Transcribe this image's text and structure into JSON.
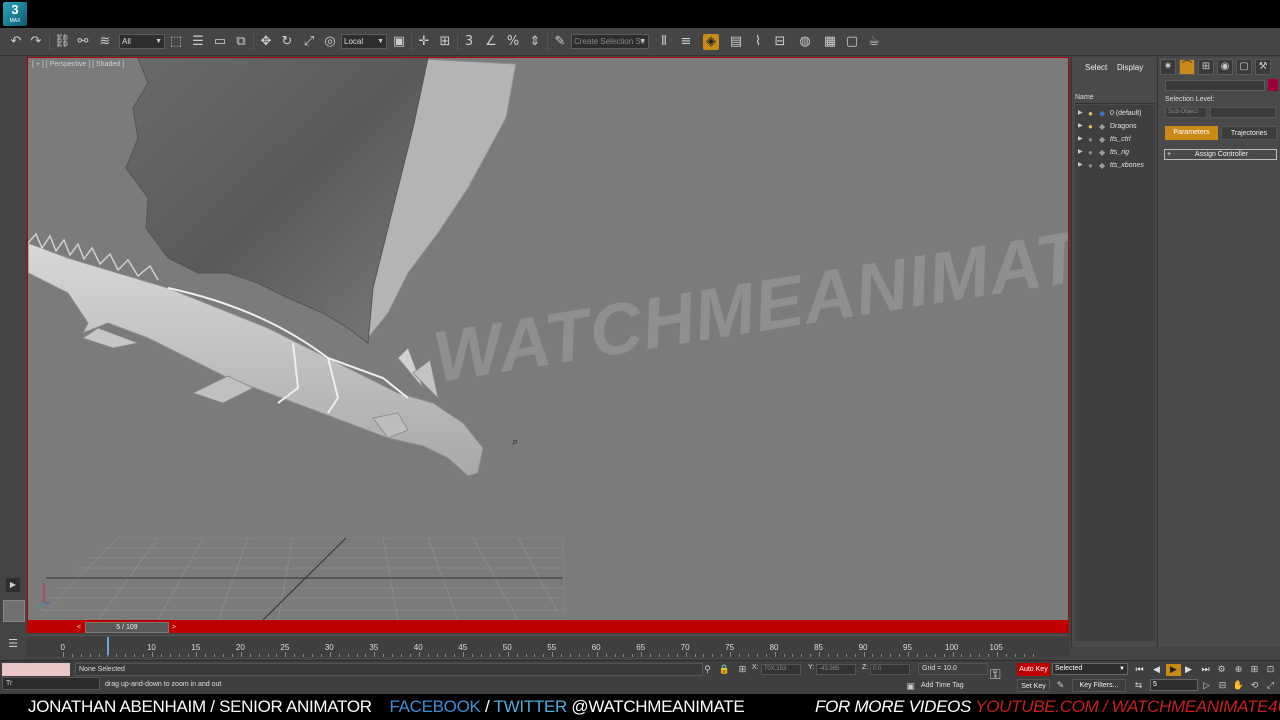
{
  "app": {
    "logo_text": "3",
    "logo_sub": "MAX"
  },
  "toolbar": {
    "selection_filter": "All",
    "reference_coord": "Local",
    "named_selection_placeholder": "Create Selection Se",
    "snap_label": "3"
  },
  "viewport": {
    "label": "[ + ] [ Perspective ] [ Shaded ]",
    "watermark": "WATCHMEANIMATE"
  },
  "scene_explorer": {
    "tab_select": "Select",
    "tab_display": "Display",
    "column_name": "Name",
    "layers": [
      {
        "label": "0 (default)",
        "italic": false
      },
      {
        "label": "Dragons",
        "italic": false
      },
      {
        "label": "tts_ctrl",
        "italic": true
      },
      {
        "label": "tts_rig",
        "italic": true
      },
      {
        "label": "tts_xbones",
        "italic": true
      }
    ]
  },
  "command_panel": {
    "selection_level_label": "Selection Level:",
    "sub_object_label": "Sub-Object",
    "parameters_label": "Parameters",
    "trajectories_label": "Trajectories",
    "assign_controller_label": "Assign Controller",
    "color_swatch": "#a0003a"
  },
  "time_slider": {
    "position_label": "5 / 109",
    "current_frame": 5,
    "total_frames": 109
  },
  "trackbar": {
    "ticks": [
      "0",
      "10",
      "15",
      "20",
      "25",
      "30",
      "35",
      "40",
      "45",
      "50",
      "55",
      "60",
      "65",
      "70",
      "75",
      "80",
      "85",
      "90",
      "95",
      "100",
      "105"
    ]
  },
  "status": {
    "selection_text": "None Selected",
    "prompt_text": "drag up-and-down to zoom in and out",
    "taskbar_label": "Tr",
    "x_label": "X:",
    "x_value": "70X.153",
    "y_label": "Y:",
    "y_value": "-43.985",
    "z_label": "Z:",
    "z_value": "0.0",
    "grid_label": "Grid = 10.0",
    "add_time_tag": "Add Time Tag",
    "auto_key": "Auto Key",
    "set_key": "Set Key",
    "selected_option": "Selected",
    "key_filters": "Key Filters...",
    "frame_value": "5"
  },
  "caption": {
    "author": "JONATHAN ABENHAIM / SENIOR ANIMATOR",
    "facebook": "FACEBOOK",
    "slash": " / ",
    "twitter": "TWITTER",
    "handle": " @WATCHMEANIMATE",
    "more_videos": "FOR MORE VIDEOS ",
    "youtube": "YOUTUBE.COM / WATCHMEANIMATE4U"
  },
  "colors": {
    "viewport_border": "#b60000",
    "auto_key_active": "#c00000",
    "accent": "#c98a1a"
  }
}
